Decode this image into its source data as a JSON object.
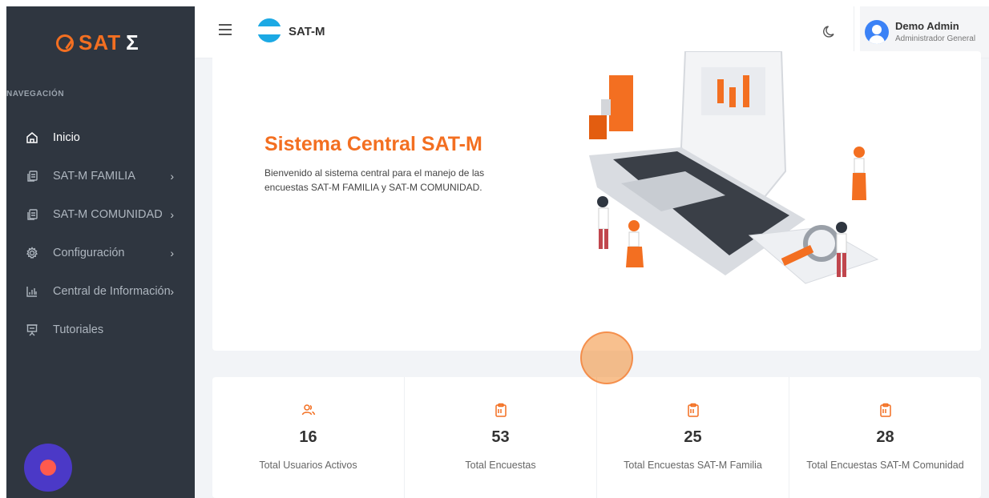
{
  "app": {
    "logo_text": "SAT",
    "brand": "SAT-M",
    "accent_color": "#f36f21",
    "sidebar_bg": "#2f3640"
  },
  "sidebar": {
    "heading": "NAVEGACIÓN",
    "items": [
      {
        "label": "Inicio",
        "icon": "home-icon",
        "active": true,
        "has_submenu": false
      },
      {
        "label": "SAT-M FAMILIA",
        "icon": "documents-icon",
        "active": false,
        "has_submenu": true
      },
      {
        "label": "SAT-M COMUNIDAD",
        "icon": "documents-icon",
        "active": false,
        "has_submenu": true
      },
      {
        "label": "Configuración",
        "icon": "gear-icon",
        "active": false,
        "has_submenu": true
      },
      {
        "label": "Central de Información",
        "icon": "bar-chart-icon",
        "active": false,
        "has_submenu": true
      },
      {
        "label": "Tutoriales",
        "icon": "presentation-icon",
        "active": false,
        "has_submenu": false
      }
    ],
    "chevron": "›"
  },
  "topbar": {
    "title": "SAT-M",
    "user": {
      "name": "Demo Admin",
      "role": "Administrador General"
    }
  },
  "hero": {
    "title": "Sistema Central SAT-M",
    "description": "Bienvenido al sistema central para el manejo de las encuestas SAT-M FAMILIA y SAT-M COMUNIDAD."
  },
  "stats": [
    {
      "icon": "users-icon",
      "value": "16",
      "label": "Total Usuarios Activos"
    },
    {
      "icon": "clipboard-icon",
      "value": "53",
      "label": "Total Encuestas"
    },
    {
      "icon": "clipboard-icon",
      "value": "25",
      "label": "Total Encuestas SAT-M Familia"
    },
    {
      "icon": "clipboard-icon",
      "value": "28",
      "label": "Total Encuestas SAT-M Comunidad"
    }
  ]
}
